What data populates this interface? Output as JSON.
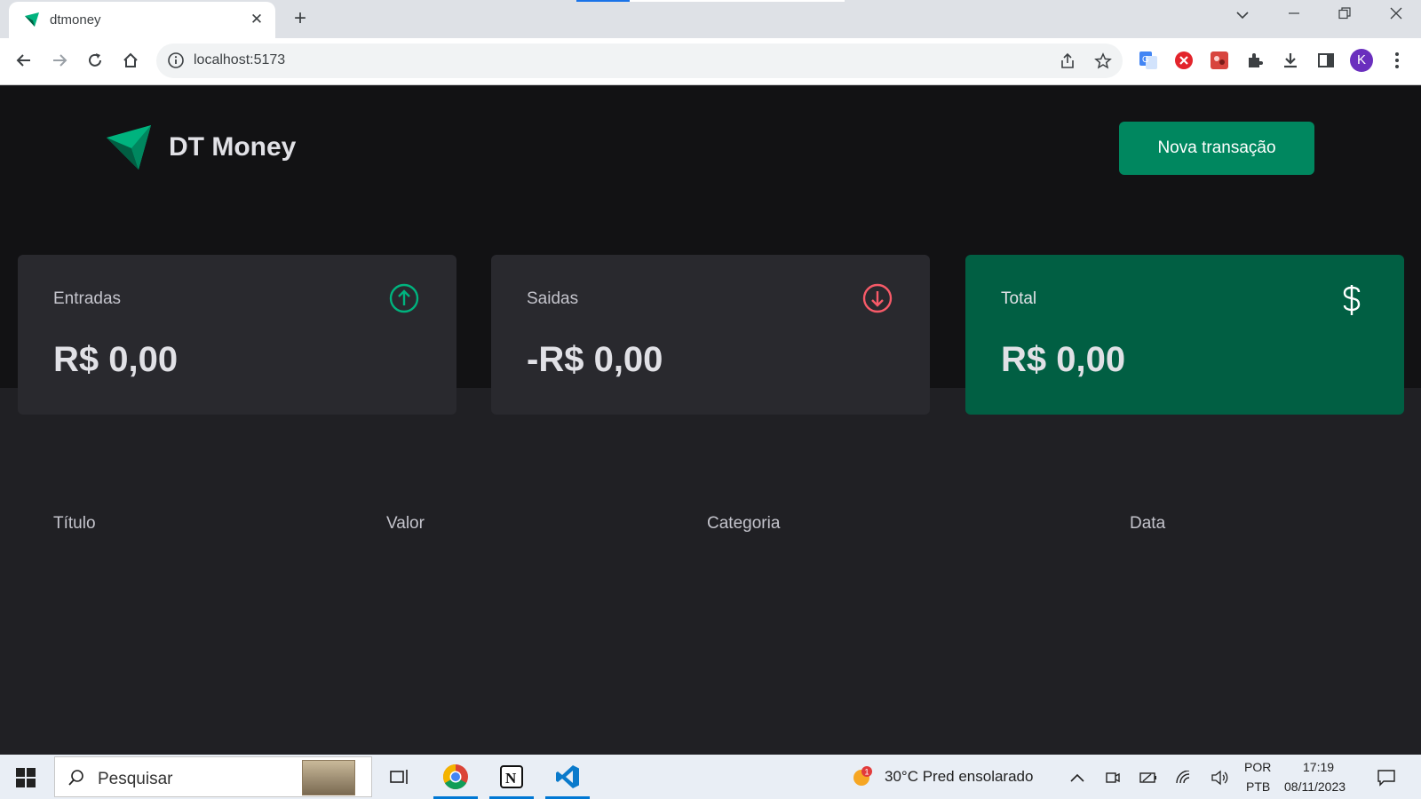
{
  "browser": {
    "tab_title": "dtmoney",
    "url": "localhost:5173",
    "profile_initial": "K"
  },
  "app": {
    "brand": "DT Money",
    "new_transaction_label": "Nova transação",
    "summary": [
      {
        "label": "Entradas",
        "value": "R$ 0,00",
        "icon": "arrow-circle-up-icon"
      },
      {
        "label": "Saidas",
        "value": "-R$ 0,00",
        "icon": "arrow-circle-down-icon"
      },
      {
        "label": "Total",
        "value": "R$ 0,00",
        "icon": "dollar-icon"
      }
    ],
    "table_headers": [
      "Título",
      "Valor",
      "Categoria",
      "Data"
    ]
  },
  "taskbar": {
    "search_placeholder": "Pesquisar",
    "weather": "30°C  Pred ensolarado",
    "weather_badge": "1",
    "lang_line1": "POR",
    "lang_line2": "PTB",
    "time": "17:19",
    "date": "08/11/2023"
  },
  "colors": {
    "background": "#202024",
    "header": "#121214",
    "card": "#29292e",
    "accent": "#00875f",
    "total_card": "#015f43",
    "income": "#00b37e",
    "outcome": "#f75a68"
  }
}
